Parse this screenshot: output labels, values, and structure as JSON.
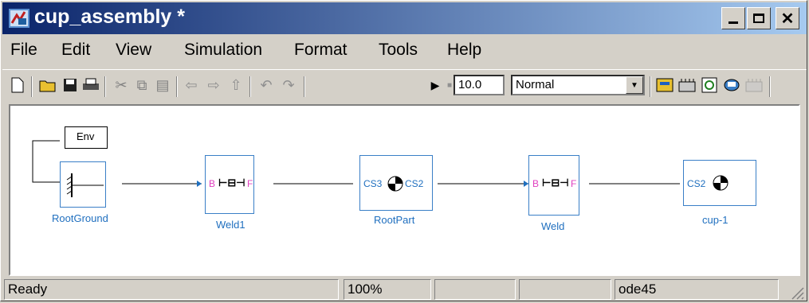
{
  "window": {
    "title": "cup_assembly *"
  },
  "menu": [
    "File",
    "Edit",
    "View",
    "Simulation",
    "Format",
    "Tools",
    "Help"
  ],
  "toolbar": {
    "stop_time": "10.0",
    "sim_mode": "Normal"
  },
  "blocks": {
    "env": "Env",
    "rootground": "RootGround",
    "weld1": "Weld1",
    "rootpart": "RootPart",
    "weld": "Weld",
    "cup": "cup-1",
    "ports": {
      "b": "B",
      "f": "F",
      "cs3": "CS3",
      "cs2": "CS2"
    }
  },
  "status": {
    "ready": "Ready",
    "zoom": "100%",
    "solver": "ode45"
  }
}
